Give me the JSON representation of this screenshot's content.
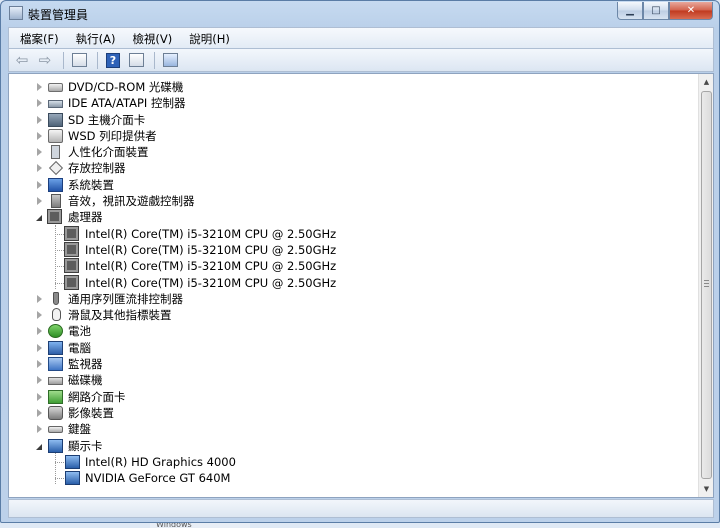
{
  "window": {
    "title": "裝置管理員"
  },
  "caption_buttons": {
    "minimize": "▁",
    "maximize": "□",
    "close": "✕"
  },
  "menu": [
    {
      "label": "檔案(F)"
    },
    {
      "label": "執行(A)"
    },
    {
      "label": "檢視(V)"
    },
    {
      "label": "說明(H)"
    }
  ],
  "toolbar": {
    "back_icon": "back-arrow-icon",
    "forward_icon": "forward-arrow-icon",
    "help_glyph": "?"
  },
  "tree": {
    "categories": [
      {
        "label": "DVD/CD-ROM 光碟機",
        "icon": "dvd-drive-icon",
        "expanded": false
      },
      {
        "label": "IDE ATA/ATAPI 控制器",
        "icon": "ide-controller-icon",
        "expanded": false
      },
      {
        "label": "SD 主機介面卡",
        "icon": "sd-host-icon",
        "expanded": false
      },
      {
        "label": "WSD 列印提供者",
        "icon": "printer-icon",
        "expanded": false
      },
      {
        "label": "人性化介面裝置",
        "icon": "hid-icon",
        "expanded": false
      },
      {
        "label": "存放控制器",
        "icon": "storage-controller-icon",
        "expanded": false
      },
      {
        "label": "系統裝置",
        "icon": "system-device-icon",
        "expanded": false
      },
      {
        "label": "音效，視訊及遊戲控制器",
        "icon": "sound-icon",
        "expanded": false
      },
      {
        "label": "處理器",
        "icon": "processor-icon",
        "expanded": true,
        "children": [
          {
            "label": "Intel(R) Core(TM) i5-3210M CPU @ 2.50GHz"
          },
          {
            "label": "Intel(R) Core(TM) i5-3210M CPU @ 2.50GHz"
          },
          {
            "label": "Intel(R) Core(TM) i5-3210M CPU @ 2.50GHz"
          },
          {
            "label": "Intel(R) Core(TM) i5-3210M CPU @ 2.50GHz"
          }
        ]
      },
      {
        "label": "通用序列匯流排控制器",
        "icon": "usb-icon",
        "expanded": false
      },
      {
        "label": "滑鼠及其他指標裝置",
        "icon": "mouse-icon",
        "expanded": false
      },
      {
        "label": "電池",
        "icon": "battery-icon",
        "expanded": false
      },
      {
        "label": "電腦",
        "icon": "computer-icon",
        "expanded": false
      },
      {
        "label": "監視器",
        "icon": "monitor-icon",
        "expanded": false
      },
      {
        "label": "磁碟機",
        "icon": "disk-drive-icon",
        "expanded": false
      },
      {
        "label": "網路介面卡",
        "icon": "network-adapter-icon",
        "expanded": false
      },
      {
        "label": "影像裝置",
        "icon": "imaging-device-icon",
        "expanded": false
      },
      {
        "label": "鍵盤",
        "icon": "keyboard-icon",
        "expanded": false
      },
      {
        "label": "顯示卡",
        "icon": "display-adapter-icon",
        "expanded": true,
        "children": [
          {
            "label": "Intel(R) HD Graphics 4000"
          },
          {
            "label": "NVIDIA GeForce GT 640M"
          }
        ]
      }
    ]
  },
  "background_fragment": "Windows"
}
